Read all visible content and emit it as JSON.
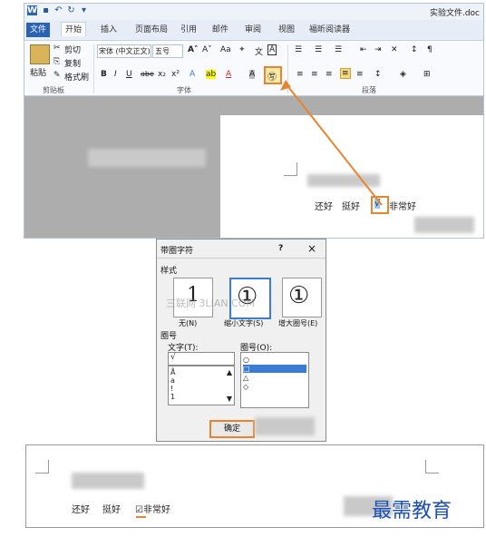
{
  "titlebar": {
    "title": "实验文件.doc"
  },
  "tabs": [
    "文件",
    "开始",
    "插入",
    "页面布局",
    "引用",
    "邮件",
    "审阅",
    "视图",
    "福昕阅读器"
  ],
  "clipboard": {
    "paste": "粘贴",
    "cut": "剪切",
    "copy": "复制",
    "format_painter": "格式刷",
    "group": "剪贴板"
  },
  "font": {
    "name": "宋体 (中文正文)",
    "size": "五号",
    "group": "字体"
  },
  "paragraph": {
    "group": "段落"
  },
  "doc1": {
    "text_a": "还好",
    "text_b": "挺好",
    "text_c": "非常好",
    "check": "√"
  },
  "dialog": {
    "title": "带圈字符",
    "help": "?",
    "close": "×",
    "style_label": "样式",
    "styles": [
      {
        "glyph": "1",
        "label": "无(N)"
      },
      {
        "glyph": "①",
        "label": "缩小文字(S)"
      },
      {
        "glyph": "①",
        "label": "增大圈号(E)"
      }
    ],
    "circle_section": "圈号",
    "text_label": "文字(T):",
    "text_value": "√",
    "text_items": [
      "Å",
      "a",
      "!",
      "1"
    ],
    "circle_label": "圈号(O):",
    "circle_items": [
      "○",
      "□",
      "△",
      "◇"
    ],
    "watermark": "三联网 3LIAN.COM",
    "ok": "确定"
  },
  "doc2": {
    "text_a": "还好",
    "text_b": "挺好",
    "text_c": "☑非常好"
  },
  "watermark": {
    "brand": "最需教育"
  }
}
